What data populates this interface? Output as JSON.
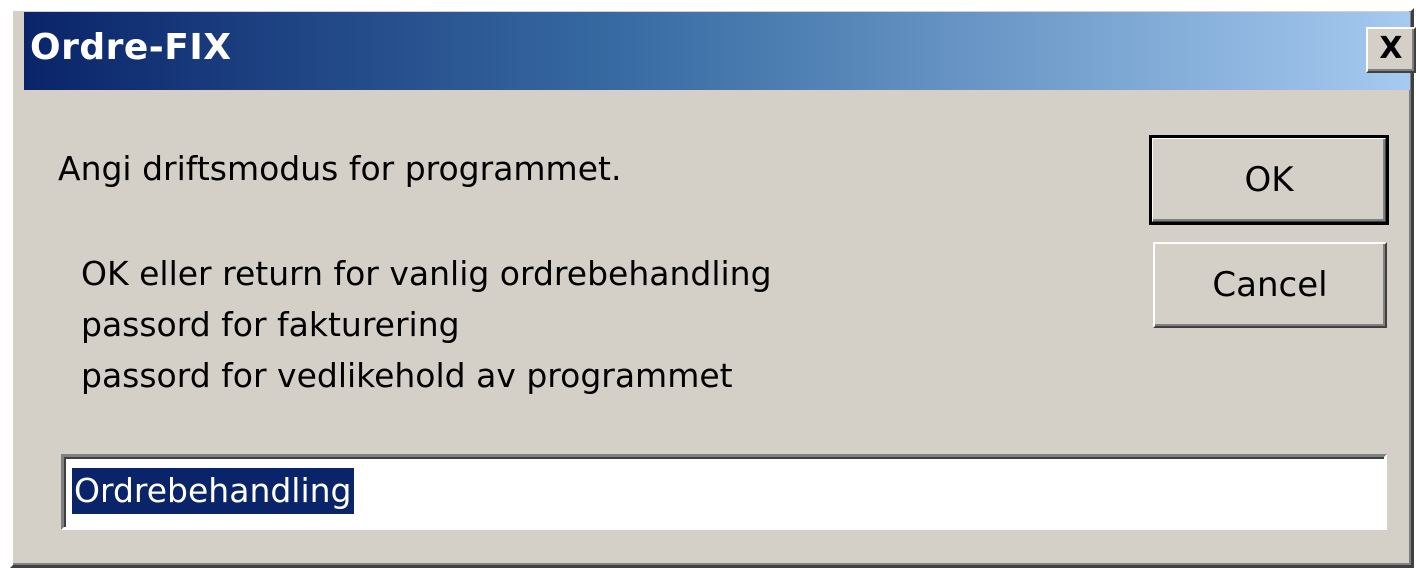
{
  "window": {
    "title": "Ordre-FIX",
    "close_glyph": "X"
  },
  "dialog": {
    "prompt": "Angi driftsmodus for programmet.",
    "options": [
      "OK eller return for vanlig ordrebehandling",
      "passord for fakturering",
      "passord for vedlikehold av programmet"
    ],
    "input_value": "Ordrebehandling"
  },
  "buttons": {
    "ok_label": "OK",
    "cancel_label": "Cancel"
  },
  "colors": {
    "titlebar_start": "#0a246a",
    "titlebar_end": "#a6caf0",
    "face": "#d4d0c8",
    "selection": "#0a246a"
  }
}
